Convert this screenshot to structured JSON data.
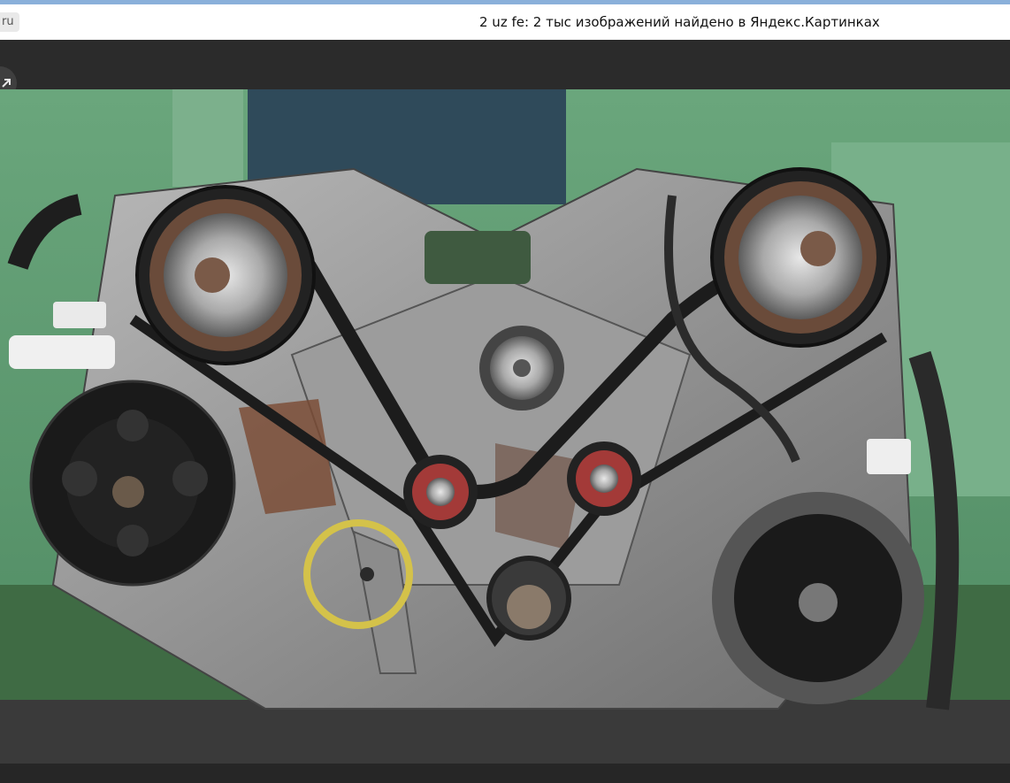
{
  "browser": {
    "domain_fragment": "ru",
    "title": "2 uz fe: 2 тыс изображений найдено в Яндекс.Картинках"
  },
  "viewer": {
    "open_icon": "external-link-icon",
    "download_icon": "download-icon"
  },
  "image": {
    "subject": "engine-photo",
    "colors": {
      "background_wall": "#5f9a73",
      "floor": "#3f6b44",
      "highlight_circle": "#d4c24a"
    }
  }
}
